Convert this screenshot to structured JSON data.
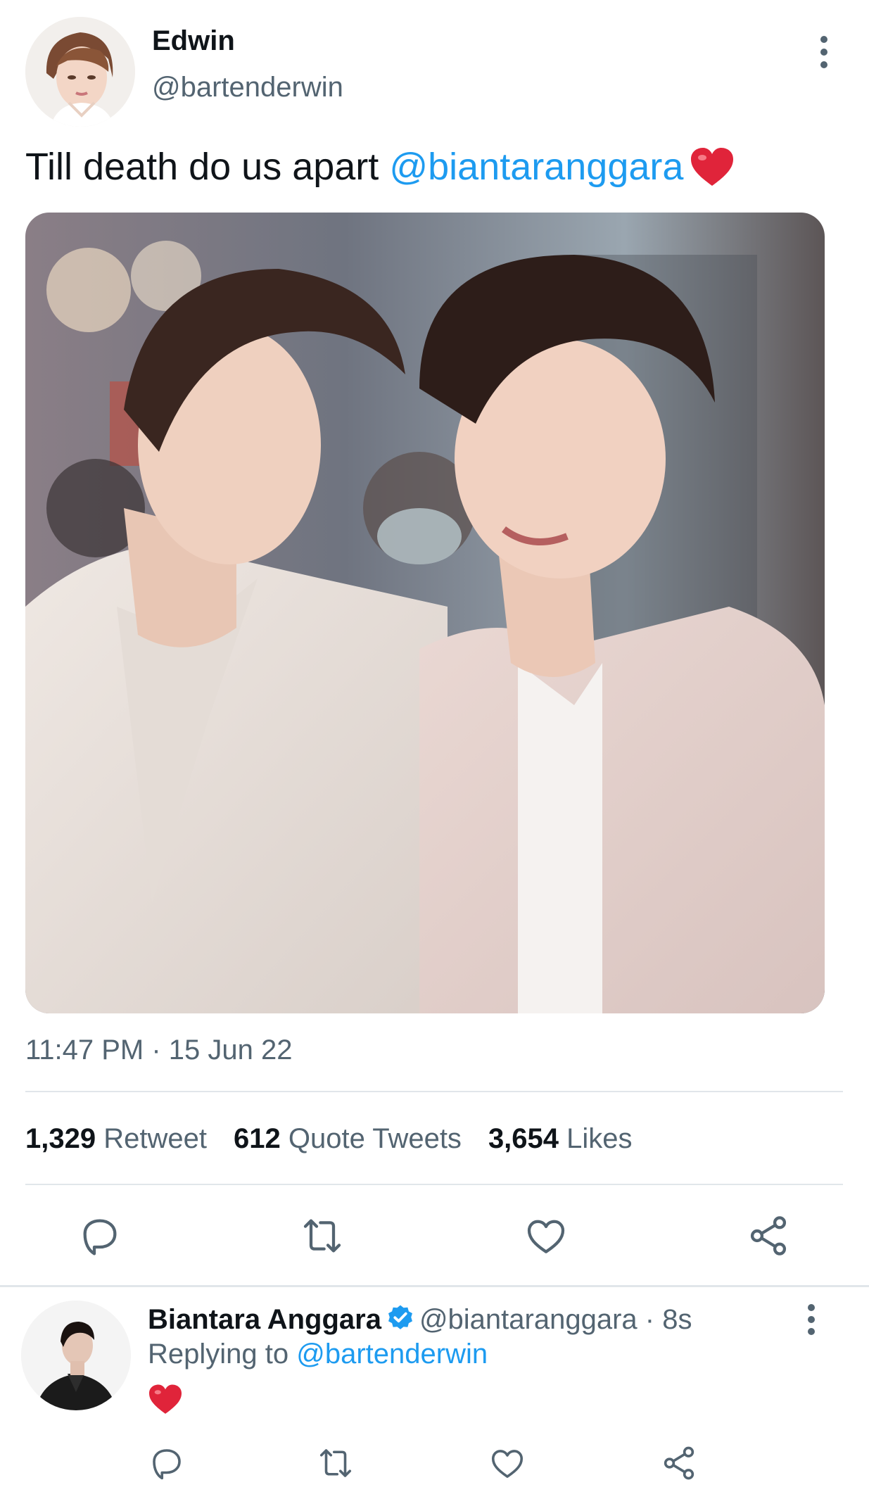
{
  "tweet": {
    "author_name": "Edwin",
    "author_handle": "@bartenderwin",
    "text_before": "Till death do us apart ",
    "mention": "@biantaranggara",
    "timestamp": "11:47 PM · 15 Jun 22",
    "stats": {
      "retweets_count": "1,329",
      "retweets_label": "Retweet",
      "quotes_count": "612",
      "quotes_label": "Quote Tweets",
      "likes_count": "3,654",
      "likes_label": "Likes"
    },
    "icons": {
      "more": "more-vertical-icon",
      "reply": "reply-icon",
      "retweet": "retweet-icon",
      "like": "heart-outline-icon",
      "share": "share-icon"
    }
  },
  "reply": {
    "author_name": "Biantara Anggara",
    "author_handle": "@biantaranggara",
    "separator": " · ",
    "time": "8s",
    "replying_prefix": "Replying to ",
    "replying_to": "@bartenderwin"
  },
  "colors": {
    "link": "#1d9bf0",
    "secondary_text": "#536471",
    "primary_text": "#0f1419",
    "heart_emoji": "#e0243a"
  }
}
